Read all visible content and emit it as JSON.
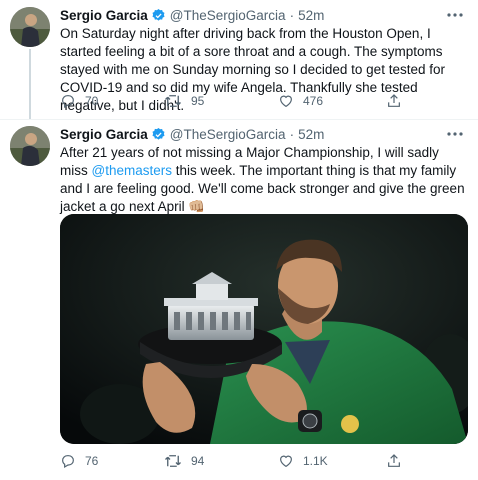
{
  "tweets": [
    {
      "name": "Sergio Garcia",
      "handle": "@TheSergioGarcia",
      "dot": "·",
      "time": "52m",
      "text": "On Saturday night after driving back from the Houston Open, I started feeling a bit of a sore throat and a cough. The symptoms stayed with me on Sunday morning so I decided to get tested for COVID-19 and so did my wife Angela. Thankfully she tested negative, but I didn't.",
      "replies": "70",
      "retweets": "95",
      "likes": "476"
    },
    {
      "name": "Sergio Garcia",
      "handle": "@TheSergioGarcia",
      "dot": "·",
      "time": "52m",
      "text_before": "After 21 years of not missing a Major Championship, I will sadly miss ",
      "mention": "@themasters",
      "text_after": " this week. The important thing is that my family and I are feeling good. We'll come back stronger and give the green jacket a go next April ",
      "emoji": "👊🏼",
      "replies": "76",
      "retweets": "94",
      "likes": "1.1K"
    }
  ],
  "icons": {
    "verified": "verified-badge-icon",
    "more": "more-dots-icon",
    "reply": "reply-icon",
    "retweet": "retweet-icon",
    "like": "heart-icon",
    "share": "share-icon"
  },
  "colors": {
    "verified": "#1d9bf0",
    "mention": "#1d9bf0",
    "secondary": "#536471",
    "jacket": "#1e7a3e"
  }
}
